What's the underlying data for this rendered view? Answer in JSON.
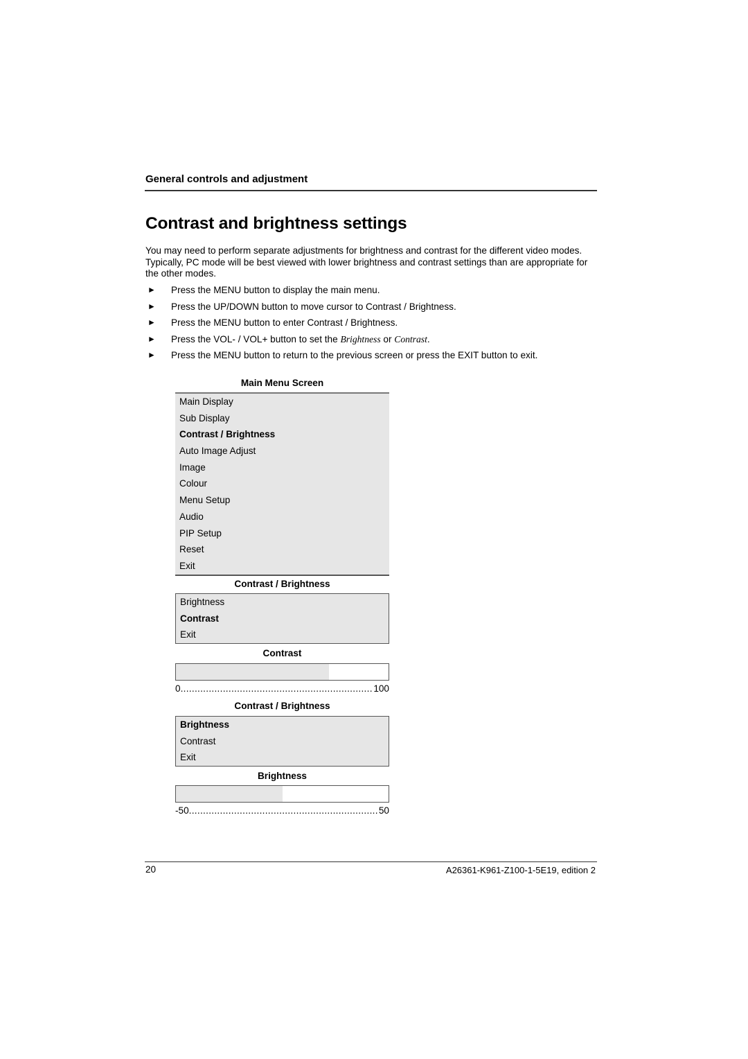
{
  "header": {
    "section": "General controls and adjustment"
  },
  "title": "Contrast and brightness settings",
  "intro": "You may need to perform separate adjustments for brightness and contrast for the different video modes. Typically, PC mode will be best viewed with lower brightness and contrast settings than are appropriate for the other modes.",
  "steps": [
    {
      "bullet": "►",
      "text": "Press the MENU button to display the main menu."
    },
    {
      "bullet": "►",
      "text": "Press the UP/DOWN button to move cursor to Contrast / Brightness."
    },
    {
      "bullet": "►",
      "text": "Press the MENU button to enter Contrast / Brightness."
    },
    {
      "bullet": "►",
      "text_before": "Press the VOL- / VOL+ button to set the ",
      "em1": "Brightness",
      "mid": " or ",
      "em2": "Contrast",
      "text_after": "."
    },
    {
      "bullet": "►",
      "text": "Press the MENU button to return to the previous screen or press the EXIT button to exit."
    }
  ],
  "main_menu": {
    "caption": "Main Menu Screen",
    "items": [
      "Main Display",
      "Sub Display",
      "Contrast / Brightness",
      "Auto Image Adjust",
      "Image",
      "Colour",
      "Menu Setup",
      "Audio",
      "PIP Setup",
      "Reset",
      "Exit"
    ],
    "selected": "Contrast / Brightness"
  },
  "submenu_contrast": {
    "caption": "Contrast / Brightness",
    "items": [
      "Brightness",
      "Contrast",
      "Exit"
    ],
    "selected": "Contrast"
  },
  "contrast_bar": {
    "caption": "Contrast",
    "min": "0",
    "max": "100",
    "dots": "..............................................................................................",
    "value_fraction": 0.72,
    "fill_color": "#e6e6e6"
  },
  "submenu_brightness": {
    "caption": "Contrast / Brightness",
    "items": [
      "Brightness",
      "Contrast",
      "Exit"
    ],
    "selected": "Brightness"
  },
  "brightness_bar": {
    "caption": "Brightness",
    "min": "-50",
    "max": "50",
    "dots": "..............................................................................................",
    "value_fraction": 0.5,
    "fill_color": "#e6e6e6"
  },
  "footer": {
    "page_number": "20",
    "doc_id": "A26361-K961-Z100-1-5E19, edition 2"
  }
}
